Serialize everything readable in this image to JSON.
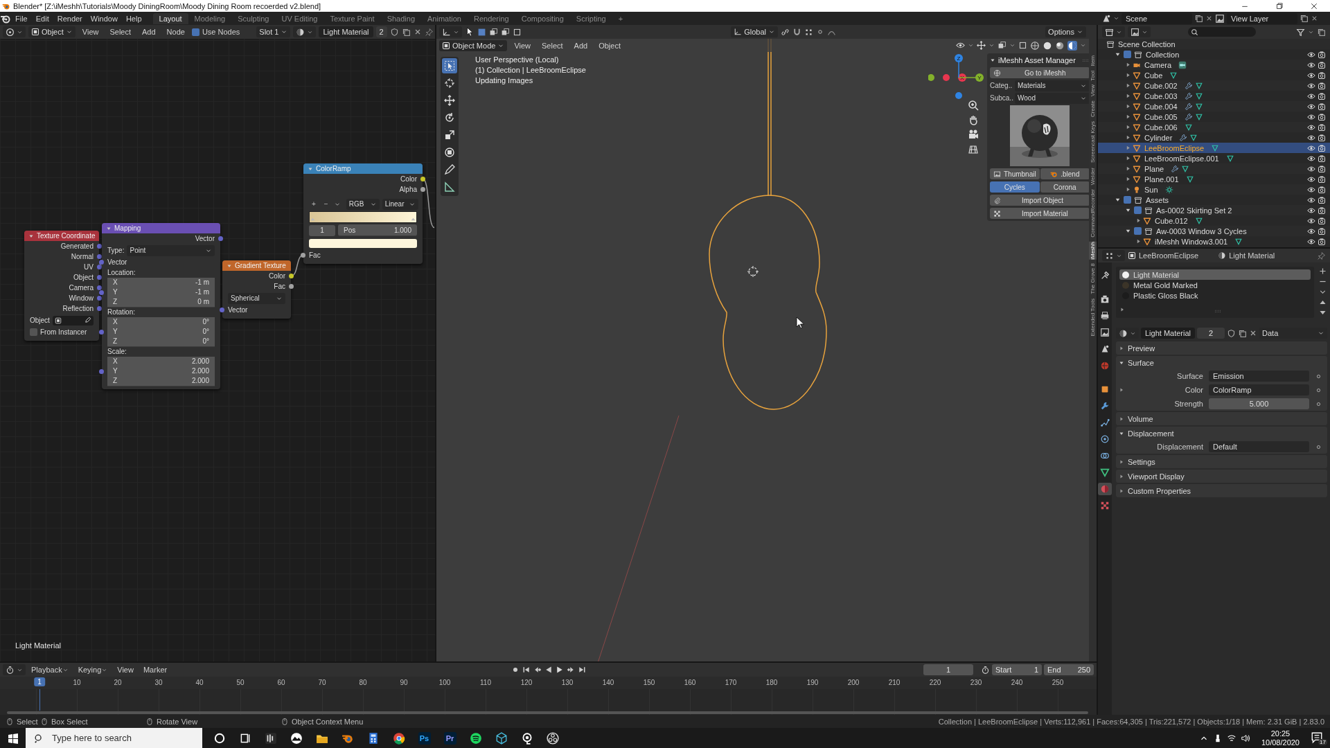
{
  "window": {
    "title": "Blender* [Z:\\iMeshh\\Tutorials\\Moody DiningRoom\\Moody Dining Room recoerded v2.blend]"
  },
  "topbar": {
    "menus": [
      "File",
      "Edit",
      "Render",
      "Window",
      "Help"
    ],
    "workspaces": [
      {
        "label": "Layout",
        "selected": true
      },
      {
        "label": "Modeling",
        "selected": false
      },
      {
        "label": "Sculpting",
        "selected": false
      },
      {
        "label": "UV Editing",
        "selected": false
      },
      {
        "label": "Texture Paint",
        "selected": false
      },
      {
        "label": "Shading",
        "selected": false
      },
      {
        "label": "Animation",
        "selected": false
      },
      {
        "label": "Rendering",
        "selected": false
      },
      {
        "label": "Compositing",
        "selected": false
      },
      {
        "label": "Scripting",
        "selected": false
      }
    ],
    "add_workspace": "+",
    "scene": "Scene",
    "view_layer": "View Layer"
  },
  "node_editor": {
    "header": {
      "object_type": "Object",
      "menus": [
        "View",
        "Select",
        "Add",
        "Node"
      ],
      "use_nodes": {
        "label": "Use Nodes",
        "checked": true
      },
      "slot": "Slot 1",
      "material": "Light Material",
      "users": "2"
    },
    "nodes": [
      {
        "title": "Texture Coordinate",
        "color": "#a8323c",
        "rows": [
          {
            "kind": "output",
            "label": "Generated",
            "color": "#6363c7"
          },
          {
            "kind": "output",
            "label": "Normal",
            "color": "#6363c7"
          },
          {
            "kind": "output",
            "label": "UV",
            "color": "#6363c7"
          },
          {
            "kind": "output",
            "label": "Object",
            "color": "#6363c7"
          },
          {
            "kind": "output",
            "label": "Camera",
            "color": "#6363c7"
          },
          {
            "kind": "output",
            "label": "Window",
            "color": "#6363c7"
          },
          {
            "kind": "output",
            "label": "Reflection",
            "color": "#6363c7"
          },
          {
            "kind": "object_field",
            "label": "Object"
          },
          {
            "kind": "checkbox",
            "label": "From Instancer",
            "checked": false
          }
        ]
      },
      {
        "title": "Mapping",
        "color": "#6a4fb3",
        "rows": [
          {
            "kind": "output",
            "label": "Vector",
            "color": "#6363c7"
          },
          {
            "kind": "dropdown",
            "label": "Type:",
            "value": "Point"
          },
          {
            "kind": "input",
            "label": "Vector",
            "color": "#6363c7"
          },
          {
            "kind": "heading",
            "label": "Location:"
          },
          {
            "kind": "field",
            "label": "X",
            "value": "-1 m"
          },
          {
            "kind": "field",
            "label": "Y",
            "value": "-1 m",
            "color": "#6363c7"
          },
          {
            "kind": "field",
            "label": "Z",
            "value": "0 m"
          },
          {
            "kind": "heading",
            "label": "Rotation:"
          },
          {
            "kind": "field",
            "label": "X",
            "value": "0°"
          },
          {
            "kind": "field",
            "label": "Y",
            "value": "0°",
            "color": "#6363c7"
          },
          {
            "kind": "field",
            "label": "Z",
            "value": "0°"
          },
          {
            "kind": "heading",
            "label": "Scale:"
          },
          {
            "kind": "field",
            "label": "X",
            "value": "2.000"
          },
          {
            "kind": "field",
            "label": "Y",
            "value": "2.000",
            "color": "#6363c7"
          },
          {
            "kind": "field",
            "label": "Z",
            "value": "2.000"
          }
        ]
      },
      {
        "title": "Gradient Texture",
        "color": "#c0662a",
        "rows": [
          {
            "kind": "output",
            "label": "Color",
            "color": "#c7c729"
          },
          {
            "kind": "output",
            "label": "Fac",
            "color": "#a1a1a1"
          },
          {
            "kind": "dropdown",
            "value": "Spherical"
          },
          {
            "kind": "input",
            "label": "Vector",
            "color": "#6363c7"
          }
        ]
      },
      {
        "title": "ColorRamp",
        "color": "#3a82b8",
        "rows": [
          {
            "kind": "output",
            "label": "Color",
            "color": "#c7c729"
          },
          {
            "kind": "output",
            "label": "Alpha",
            "color": "#a1a1a1"
          },
          {
            "kind": "ramp_tools",
            "add": "+",
            "remove": "−",
            "mode": "RGB",
            "interpolation": "Linear"
          },
          {
            "kind": "ramp_bar"
          },
          {
            "kind": "ramp_stop",
            "index": "1",
            "label": "Pos",
            "value": "1.000"
          },
          {
            "kind": "swatch",
            "color": "#fdf6dc"
          },
          {
            "kind": "input",
            "label": "Fac",
            "color": "#a1a1a1"
          }
        ]
      }
    ],
    "footer": "Light Material"
  },
  "viewport": {
    "header": {
      "orientation": "Global",
      "options": "Options",
      "mode": "Object Mode",
      "menus": [
        "View",
        "Select",
        "Add",
        "Object"
      ],
      "shading": [
        {
          "kind": "wireframe",
          "selected": false
        },
        {
          "kind": "solid",
          "selected": false
        },
        {
          "kind": "material",
          "selected": false
        },
        {
          "kind": "rendered",
          "selected": true
        }
      ]
    },
    "tools": [
      {
        "kind": "select",
        "selected": true
      },
      {
        "kind": "cursor",
        "selected": false
      },
      {
        "kind": "move",
        "selected": false
      },
      {
        "kind": "rotate",
        "selected": false
      },
      {
        "kind": "scale",
        "selected": false
      },
      {
        "kind": "transform",
        "selected": false
      },
      {
        "kind": "annotate",
        "selected": false
      },
      {
        "kind": "measure",
        "selected": false
      }
    ],
    "info": [
      "User Perspective (Local)",
      "(1) Collection | LeeBroomEclipse",
      "Updating Images"
    ],
    "gizmo_axes": [
      {
        "label": "X",
        "color": "#e8364f"
      },
      {
        "label": "Y",
        "color": "#83b12b"
      },
      {
        "label": "Z",
        "color": "#2f84e3"
      }
    ],
    "side_tabs": [
      {
        "label": "Item",
        "selected": false
      },
      {
        "label": "Tool",
        "selected": false
      },
      {
        "label": "View",
        "selected": false
      },
      {
        "label": "Create",
        "selected": false
      },
      {
        "label": "Screencast Keys",
        "selected": false
      },
      {
        "label": "Welder",
        "selected": false
      },
      {
        "label": "CommandRecorder",
        "selected": false
      },
      {
        "label": "iMeshh",
        "selected": true
      },
      {
        "label": "The Grove 8",
        "selected": false
      },
      {
        "label": "Extended Tools",
        "selected": false
      }
    ],
    "asset_manager": {
      "title": "iMeshh Asset Manager",
      "go_button": "Go to iMeshh",
      "fields": [
        {
          "label": "Categ..",
          "value": "Materials"
        },
        {
          "label": "Subca..",
          "value": "Wood"
        }
      ],
      "thumbnail": {
        "kind": "picture"
      },
      "preview_buttons": [
        "Thumbnail",
        ".blend"
      ],
      "engines": [
        {
          "label": "Cycles",
          "selected": true
        },
        {
          "label": "Corona",
          "selected": false
        }
      ],
      "import_buttons": [
        "Import Object",
        "Import Material"
      ]
    }
  },
  "outliner": {
    "root": "Scene Collection",
    "items": [
      {
        "label": "Collection",
        "kind": "collection",
        "checked": true,
        "expanded": true,
        "selected": false,
        "children": [
          {
            "label": "Camera",
            "kind": "camera",
            "modifier": false,
            "expanded": false,
            "selected": false
          },
          {
            "label": "Cube",
            "kind": "mesh",
            "modifier": false,
            "expanded": false,
            "selected": false
          },
          {
            "label": "Cube.002",
            "kind": "mesh",
            "modifier": true,
            "expanded": false,
            "selected": false
          },
          {
            "label": "Cube.003",
            "kind": "mesh",
            "modifier": true,
            "expanded": false,
            "selected": false
          },
          {
            "label": "Cube.004",
            "kind": "mesh",
            "modifier": true,
            "expanded": false,
            "selected": false
          },
          {
            "label": "Cube.005",
            "kind": "mesh",
            "modifier": true,
            "expanded": false,
            "selected": false
          },
          {
            "label": "Cube.006",
            "kind": "mesh",
            "modifier": false,
            "expanded": false,
            "selected": false
          },
          {
            "label": "Cylinder",
            "kind": "mesh",
            "modifier": true,
            "expanded": false,
            "selected": false
          },
          {
            "label": "LeeBroomEclipse",
            "kind": "mesh",
            "modifier": false,
            "expanded": false,
            "selected": true
          },
          {
            "label": "LeeBroomEclipse.001",
            "kind": "mesh",
            "modifier": false,
            "expanded": false,
            "selected": false
          },
          {
            "label": "Plane",
            "kind": "mesh",
            "modifier": true,
            "expanded": false,
            "selected": false
          },
          {
            "label": "Plane.001",
            "kind": "mesh",
            "modifier": false,
            "expanded": false,
            "selected": false
          },
          {
            "label": "Sun",
            "kind": "light",
            "modifier": false,
            "expanded": false,
            "selected": false
          }
        ]
      },
      {
        "label": "Assets",
        "kind": "collection",
        "checked": true,
        "expanded": true,
        "selected": false,
        "children": [
          {
            "label": "As-0002 Skirting Set 2",
            "kind": "collection",
            "checked": true,
            "expanded": true,
            "selected": false,
            "children": [
              {
                "label": "Cube.012",
                "kind": "mesh",
                "modifier": false,
                "expanded": false,
                "selected": false
              }
            ]
          },
          {
            "label": "Aw-0003 Window 3 Cycles",
            "kind": "collection",
            "checked": true,
            "expanded": true,
            "selected": false,
            "children": [
              {
                "label": "iMeshh Window3.001",
                "kind": "mesh",
                "modifier": false,
                "expanded": false,
                "selected": false
              }
            ]
          }
        ]
      }
    ]
  },
  "properties": {
    "object": "LeeBroomEclipse",
    "material": "Light Material",
    "tabs": [
      {
        "kind": "tool",
        "selected": false
      },
      {
        "kind": "render",
        "selected": false
      },
      {
        "kind": "output",
        "selected": false
      },
      {
        "kind": "view_layer",
        "selected": false
      },
      {
        "kind": "scene",
        "selected": false
      },
      {
        "kind": "world",
        "selected": false
      },
      {
        "kind": "object",
        "selected": false
      },
      {
        "kind": "modifiers",
        "selected": false
      },
      {
        "kind": "particles",
        "selected": false
      },
      {
        "kind": "physics",
        "selected": false
      },
      {
        "kind": "constraints",
        "selected": false
      },
      {
        "kind": "data",
        "selected": false
      },
      {
        "kind": "material",
        "selected": true
      },
      {
        "kind": "texture",
        "selected": false
      }
    ],
    "slots": [
      {
        "label": "Light Material",
        "selected": true,
        "color": "#f2f2f2"
      },
      {
        "label": "Metal Gold Marked",
        "selected": false,
        "color": "#3b3428"
      },
      {
        "label": "Plastic Gloss Black",
        "selected": false,
        "color": "#1c1c1c"
      }
    ],
    "datablock": {
      "name": "Light Material",
      "users": "2",
      "link": "Data"
    },
    "panels": [
      {
        "label": "Preview",
        "expanded": false
      },
      {
        "label": "Surface",
        "expanded": true,
        "fields": [
          {
            "label": "Surface",
            "value": "Emission",
            "kind": "menu"
          },
          {
            "label": "Color",
            "value": "ColorRamp",
            "kind": "menu",
            "expandable": true
          },
          {
            "label": "Strength",
            "value": "5.000",
            "kind": "number"
          }
        ]
      },
      {
        "label": "Volume",
        "expanded": false
      },
      {
        "label": "Displacement",
        "expanded": true,
        "fields": [
          {
            "label": "Displacement",
            "value": "Default",
            "kind": "menu"
          }
        ]
      },
      {
        "label": "Settings",
        "expanded": false
      },
      {
        "label": "Viewport Display",
        "expanded": false
      },
      {
        "label": "Custom Properties",
        "expanded": false
      }
    ]
  },
  "timeline": {
    "menus": [
      {
        "label": "Playback",
        "kind": "dropdown"
      },
      {
        "label": "Keying",
        "kind": "dropdown"
      },
      {
        "label": "View",
        "kind": "menu"
      },
      {
        "label": "Marker",
        "kind": "menu"
      }
    ],
    "frame": "1",
    "start": {
      "label": "Start",
      "value": "1"
    },
    "end": {
      "label": "End",
      "value": "250"
    },
    "current_frame": "1",
    "ruler": [
      "10",
      "20",
      "30",
      "40",
      "50",
      "60",
      "70",
      "80",
      "90",
      "100",
      "110",
      "120",
      "130",
      "140",
      "150",
      "160",
      "170",
      "180",
      "190",
      "200",
      "210",
      "220",
      "230",
      "240",
      "250"
    ]
  },
  "status": {
    "hints": [
      "Select",
      "Box Select",
      "Rotate View",
      "Object Context Menu"
    ],
    "stats": "Collection | LeeBroomEclipse | Verts:112,961 | Faces:64,305 | Tris:221,572 | Objects:1/18 | Mem: 2.31 GiB | 2.83.0"
  },
  "taskbar": {
    "search": {
      "placeholder": "Type here to search"
    },
    "app_labels": [
      {
        "label": "Ps",
        "color": "#31a8ff"
      },
      {
        "label": "Pr",
        "color": "#9999ff"
      }
    ],
    "time": "20:25",
    "date": "10/08/2020",
    "notifications": "17"
  }
}
